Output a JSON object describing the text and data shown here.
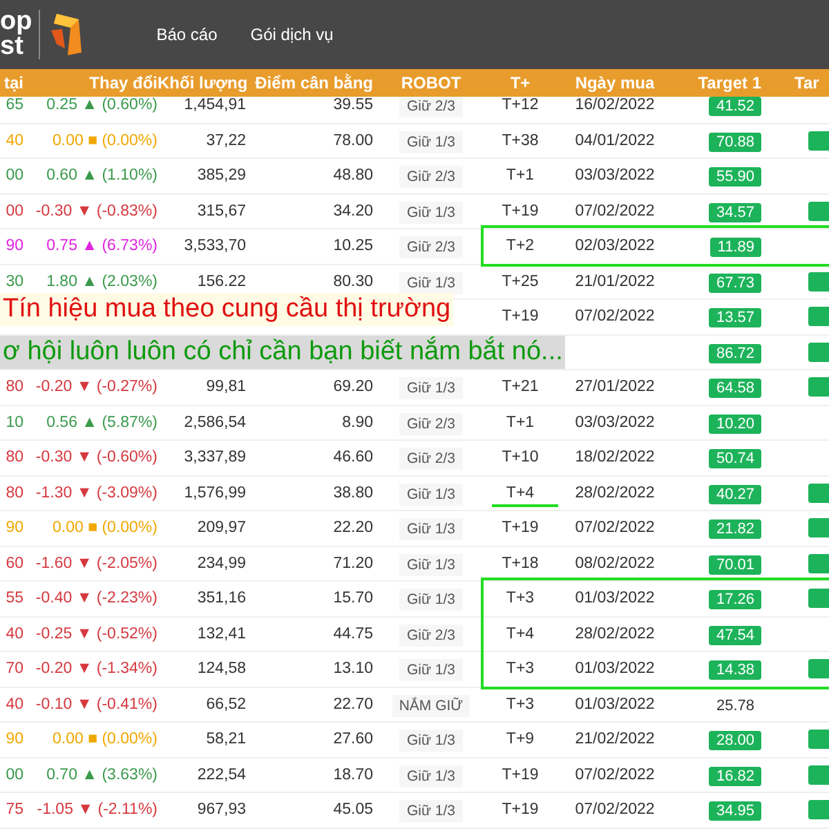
{
  "logo": {
    "line_1": "op",
    "line_2": "st"
  },
  "nav": [
    {
      "label": "Báo cáo"
    },
    {
      "label": "Gói dịch vụ"
    }
  ],
  "table": {
    "columns": [
      "tại",
      "Thay đổi",
      "Khối lượng",
      "Điểm cân bằng",
      "ROBOT",
      "T+",
      "Ngày mua",
      "Target 1",
      "Tar"
    ],
    "rows": [
      {
        "price": "65",
        "change": "0.25 ▲ (0.60%)",
        "color": "#3a9a4c",
        "volume": "1,454,91",
        "balance": "39.55",
        "robot": "Giữ 2/3",
        "t": "T+12",
        "date": "16/02/2022",
        "target_1": "41.52",
        "target_1_hit": true,
        "target_2_hit": false
      },
      {
        "price": "40",
        "change": "0.00 ■ (0.00%)",
        "color": "#f0a800",
        "volume": "37,22",
        "balance": "78.00",
        "robot": "Giữ 1/3",
        "t": "T+38",
        "date": "04/01/2022",
        "target_1": "70.88",
        "target_1_hit": true,
        "target_2_hit": true
      },
      {
        "price": "00",
        "change": "0.60 ▲ (1.10%)",
        "color": "#3a9a4c",
        "volume": "385,29",
        "balance": "48.80",
        "robot": "Giữ 2/3",
        "t": "T+1",
        "date": "03/03/2022",
        "target_1": "55.90",
        "target_1_hit": true,
        "target_2_hit": false
      },
      {
        "price": "00",
        "change": "-0.30 ▼ (-0.83%)",
        "color": "#d5393f",
        "volume": "315,67",
        "balance": "34.20",
        "robot": "Giữ 1/3",
        "t": "T+19",
        "date": "07/02/2022",
        "target_1": "34.57",
        "target_1_hit": true,
        "target_2_hit": true
      },
      {
        "price": "90",
        "change": "0.75 ▲ (6.73%)",
        "color": "#e024e0",
        "volume": "3,533,70",
        "balance": "10.25",
        "robot": "Giữ 2/3",
        "t": "T+2",
        "date": "02/03/2022",
        "target_1": "11.89",
        "target_1_hit": true,
        "target_2_hit": false,
        "framed": true
      },
      {
        "price": "30",
        "change": "1.80 ▲ (2.03%)",
        "color": "#3a9a4c",
        "volume": "156.22",
        "balance": "80.30",
        "robot": "Giữ 1/3",
        "t": "T+25",
        "date": "21/01/2022",
        "target_1": "67.73",
        "target_1_hit": true,
        "target_2_hit": true
      },
      {
        "t": "T+19",
        "date": "07/02/2022",
        "target_1": "13.57",
        "target_1_hit": true,
        "target_2_hit": true
      },
      {
        "target_1": "86.72",
        "target_1_hit": true,
        "target_2_hit": true
      },
      {
        "price": "80",
        "change": "-0.20 ▼ (-0.27%)",
        "color": "#d5393f",
        "volume": "99,81",
        "balance": "69.20",
        "robot": "Giữ 1/3",
        "t": "T+21",
        "date": "27/01/2022",
        "target_1": "64.58",
        "target_1_hit": true,
        "target_2_hit": true
      },
      {
        "price": "10",
        "change": "0.56 ▲ (5.87%)",
        "color": "#3a9a4c",
        "volume": "2,586,54",
        "balance": "8.90",
        "robot": "Giữ 2/3",
        "t": "T+1",
        "date": "03/03/2022",
        "target_1": "10.20",
        "target_1_hit": true,
        "target_2_hit": false
      },
      {
        "price": "80",
        "change": "-0.30 ▼ (-0.60%)",
        "color": "#d5393f",
        "volume": "3,337,89",
        "balance": "46.60",
        "robot": "Giữ 2/3",
        "t": "T+10",
        "date": "18/02/2022",
        "target_1": "50.74",
        "target_1_hit": true,
        "target_2_hit": false
      },
      {
        "price": "80",
        "change": "-1.30 ▼ (-3.09%)",
        "color": "#d5393f",
        "volume": "1,576,99",
        "balance": "38.80",
        "robot": "Giữ 1/3",
        "t": "T+4",
        "date": "28/02/2022",
        "target_1": "40.27",
        "target_1_hit": true,
        "target_2_hit": true,
        "underlined": true
      },
      {
        "price": "90",
        "change": "0.00 ■ (0.00%)",
        "color": "#f0a800",
        "volume": "209,97",
        "balance": "22.20",
        "robot": "Giữ 1/3",
        "t": "T+19",
        "date": "07/02/2022",
        "target_1": "21.82",
        "target_1_hit": true,
        "target_2_hit": true
      },
      {
        "price": "60",
        "change": "-1.60 ▼ (-2.05%)",
        "color": "#d5393f",
        "volume": "234,99",
        "balance": "71.20",
        "robot": "Giữ 1/3",
        "t": "T+18",
        "date": "08/02/2022",
        "target_1": "70.01",
        "target_1_hit": true,
        "target_2_hit": true
      },
      {
        "price": "55",
        "change": "-0.40 ▼ (-2.23%)",
        "color": "#d5393f",
        "volume": "351,16",
        "balance": "15.70",
        "robot": "Giữ 1/3",
        "t": "T+3",
        "date": "01/03/2022",
        "target_1": "17.26",
        "target_1_hit": true,
        "target_2_hit": true,
        "framed": true
      },
      {
        "price": "40",
        "change": "-0.25 ▼ (-0.52%)",
        "color": "#d5393f",
        "volume": "132,41",
        "balance": "44.75",
        "robot": "Giữ 2/3",
        "t": "T+4",
        "date": "28/02/2022",
        "target_1": "47.54",
        "target_1_hit": true,
        "target_2_hit": false,
        "framed": true
      },
      {
        "price": "70",
        "change": "-0.20 ▼ (-1.34%)",
        "color": "#d5393f",
        "volume": "124,58",
        "balance": "13.10",
        "robot": "Giữ 1/3",
        "t": "T+3",
        "date": "01/03/2022",
        "target_1": "14.38",
        "target_1_hit": true,
        "target_2_hit": true,
        "framed": true
      },
      {
        "price": "40",
        "change": "-0.10 ▼ (-0.41%)",
        "color": "#d5393f",
        "volume": "66,52",
        "balance": "22.70",
        "robot": "NẮM GIỮ",
        "t": "T+3",
        "date": "01/03/2022",
        "target_1": "25.78",
        "target_1_hit": false,
        "target_2_hit": false
      },
      {
        "price": "90",
        "change": "0.00 ■ (0.00%)",
        "color": "#f0a800",
        "volume": "58,21",
        "balance": "27.60",
        "robot": "Giữ 1/3",
        "t": "T+9",
        "date": "21/02/2022",
        "target_1": "28.00",
        "target_1_hit": true,
        "target_2_hit": true
      },
      {
        "price": "00",
        "change": "0.70 ▲ (3.63%)",
        "color": "#3a9a4c",
        "volume": "222,54",
        "balance": "18.70",
        "robot": "Giữ 1/3",
        "t": "T+19",
        "date": "07/02/2022",
        "target_1": "16.82",
        "target_1_hit": true,
        "target_2_hit": true
      },
      {
        "price": "75",
        "change": "-1.05 ▼ (-2.11%)",
        "color": "#d5393f",
        "volume": "967,93",
        "balance": "45.05",
        "robot": "Giữ 1/3",
        "t": "T+19",
        "date": "07/02/2022",
        "target_1": "34.95",
        "target_1_hit": true,
        "target_2_hit": true
      }
    ]
  },
  "captions": [
    {
      "text": "Tín hiệu mua theo cung cầu thị trường",
      "kind": "headline"
    },
    {
      "text": "ơ hội luôn luôn có chỉ cần bạn biết nắm bắt nó...",
      "kind": "subline"
    }
  ]
}
